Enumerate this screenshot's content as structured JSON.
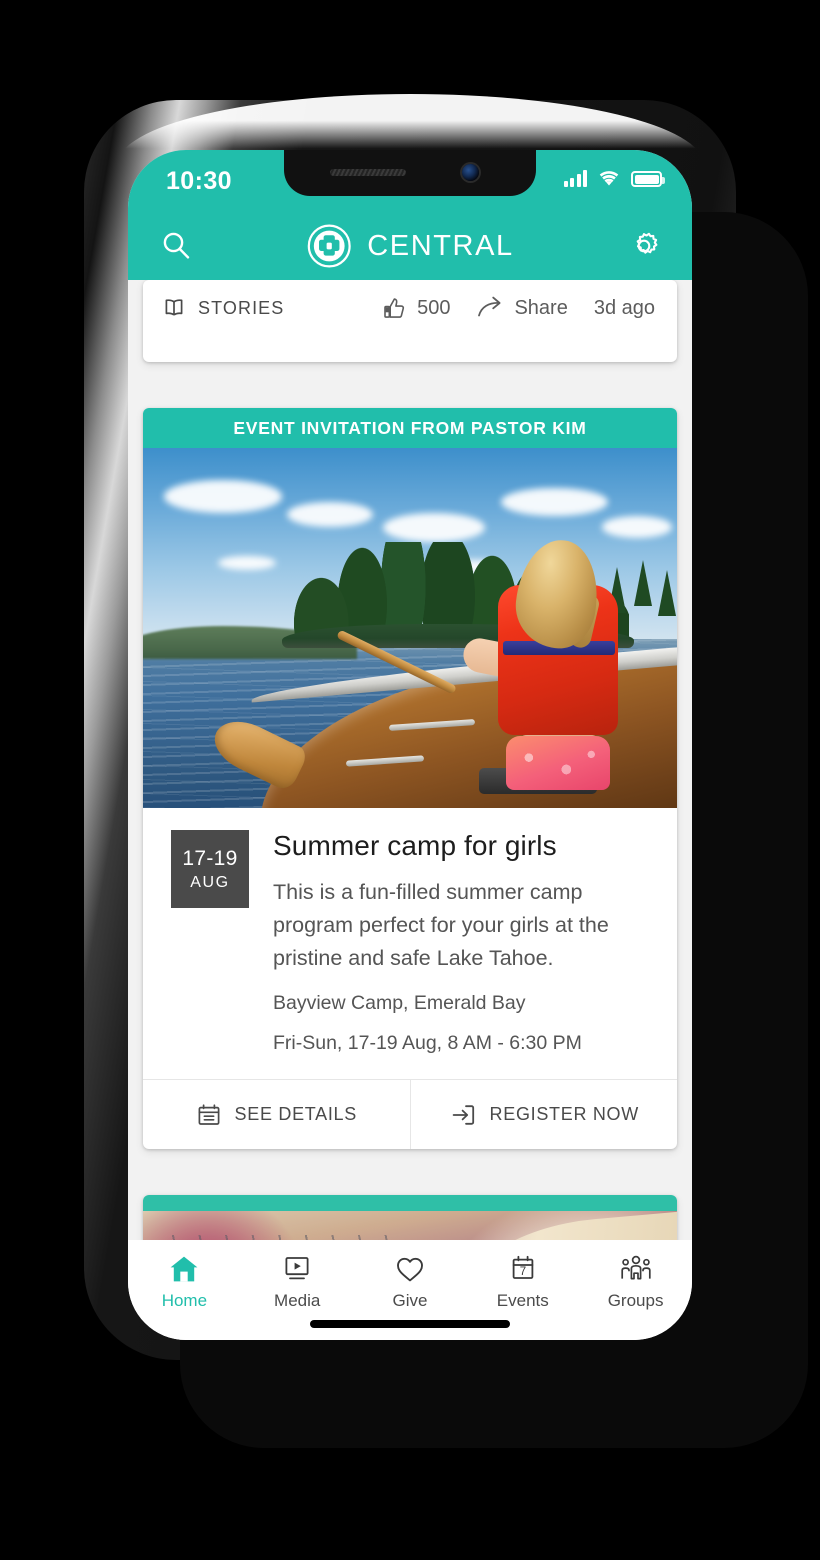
{
  "theme": {
    "accent": "#21beab",
    "banner": "#21beab",
    "badge_bg": "#4a4a4a",
    "feed_bg": "#f2f2f2",
    "card_bg": "#ffffff",
    "text_primary": "#1d1d1d",
    "text_secondary": "#555555"
  },
  "status_bar": {
    "time": "10:30",
    "icons": [
      "signal-bars-icon",
      "wifi-icon",
      "battery-icon"
    ]
  },
  "app_bar": {
    "title": "CENTRAL",
    "logo_icon": "cross-in-circle-logo-icon",
    "left_icon": "search-icon",
    "right_icon": "gear-icon"
  },
  "stories_card": {
    "label": "STORIES",
    "label_icon": "open-book-icon",
    "actions": [
      {
        "icon": "thumbs-up-icon",
        "text": "500",
        "name": "like-action"
      },
      {
        "icon": "share-arrow-icon",
        "text": "Share",
        "name": "share-action"
      },
      {
        "icon": "",
        "text": "3d ago",
        "name": "timestamp"
      }
    ]
  },
  "event_card": {
    "banner": "EVENT INVITATION FROM PASTOR KIM",
    "photo_alt": "girl-in-red-life-vest-paddling-canoe-on-lake",
    "date_badge": {
      "range": "17-19",
      "month": "AUG"
    },
    "title": "Summer camp for girls",
    "description": "This is a fun-filled summer camp program perfect for your girls at the pristine and safe Lake Tahoe.",
    "location": "Bayview Camp, Emerald Bay",
    "when": "Fri-Sun, 17-19 Aug, 8 AM - 6:30 PM",
    "footer": [
      {
        "label": "SEE DETAILS",
        "icon": "calendar-icon",
        "name": "see-details-button"
      },
      {
        "label": "REGISTER NOW",
        "icon": "enter-arrow-icon",
        "name": "register-now-button"
      }
    ]
  },
  "next_card": {
    "photo_alt": "boardwalk-path-through-autumn-grass"
  },
  "bottom_nav": {
    "items": [
      {
        "label": "Home",
        "icon": "home-icon",
        "active": true
      },
      {
        "label": "Media",
        "icon": "play-screen-icon",
        "active": false
      },
      {
        "label": "Give",
        "icon": "heart-icon",
        "active": false
      },
      {
        "label": "Events",
        "icon": "calendar-7-icon",
        "active": false,
        "badge_number": "7"
      },
      {
        "label": "Groups",
        "icon": "people-group-icon",
        "active": false
      }
    ]
  }
}
